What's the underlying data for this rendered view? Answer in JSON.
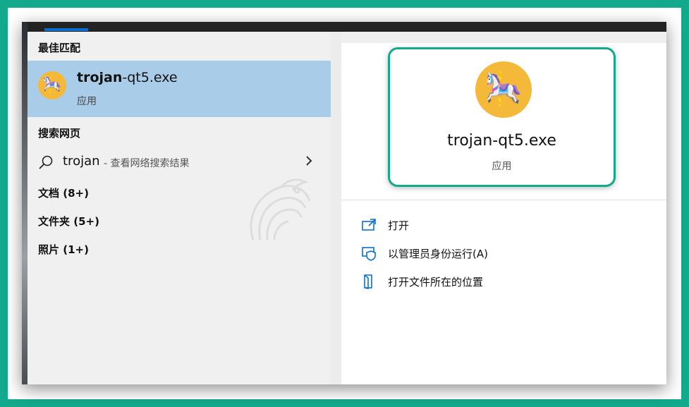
{
  "left": {
    "best_match_header": "最佳匹配",
    "best_match": {
      "name_bold": "trojan",
      "name_rest": "-qt5.exe",
      "type": "应用",
      "icon": "rocking-horse-icon"
    },
    "web_header": "搜索网页",
    "web_search": {
      "query": "trojan",
      "hint": "- 查看网络搜索结果"
    },
    "categories": [
      {
        "label": "文档 (8+)"
      },
      {
        "label": "文件夹 (5+)"
      },
      {
        "label": "照片 (1+)"
      }
    ]
  },
  "right": {
    "title": "trojan-qt5.exe",
    "type": "应用",
    "actions": [
      {
        "label": "打开",
        "icon": "open-icon"
      },
      {
        "label": "以管理员身份运行(A)",
        "icon": "admin-shield-icon"
      },
      {
        "label": "打开文件所在的位置",
        "icon": "file-location-icon"
      }
    ]
  },
  "colors": {
    "accent": "#13a98c",
    "selected": "#a9cde8",
    "icon_blue": "#0a6fd0",
    "app_icon_bg": "#f5b93a"
  }
}
